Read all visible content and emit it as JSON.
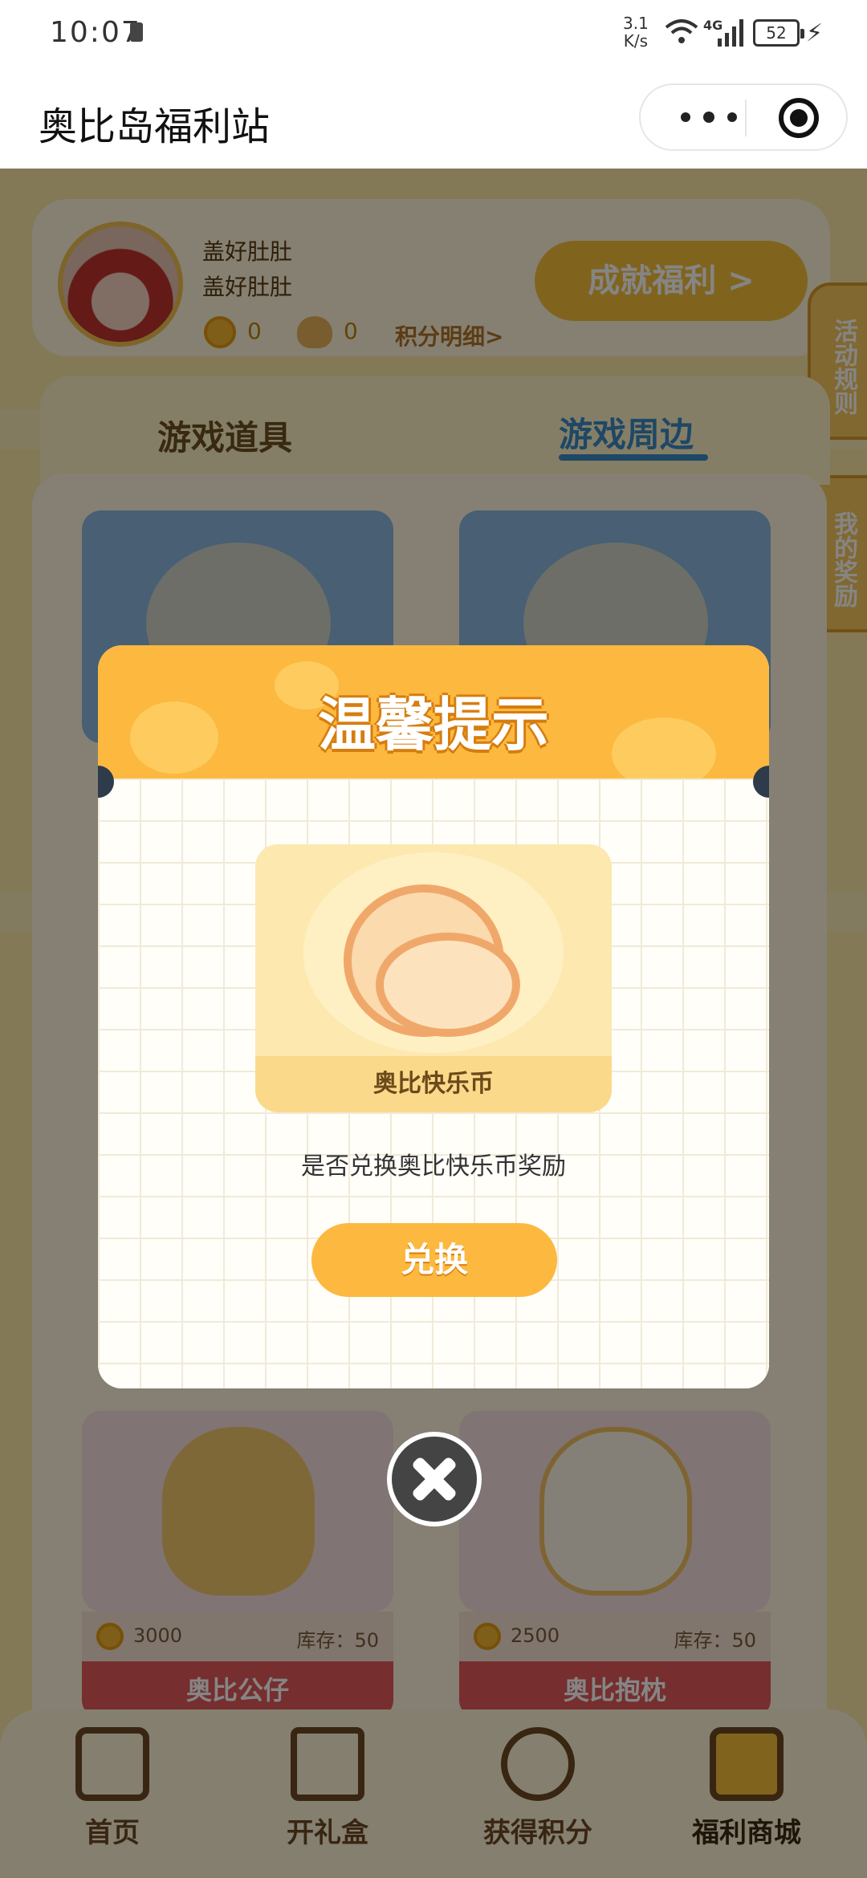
{
  "status_bar": {
    "time": "10:07",
    "speed_value": "3.1",
    "speed_unit": "K/s",
    "network": "4G",
    "battery": "52"
  },
  "title_bar": {
    "title": "奥比岛福利站"
  },
  "profile": {
    "name_line1": "盖好肚肚",
    "name_line2": "盖好肚肚",
    "coins": "0",
    "points": "0",
    "detail_link": "积分明细>",
    "achievement_button": "成就福利 >"
  },
  "side_tabs": {
    "rules": "活动规则",
    "rewards": "我的奖励"
  },
  "category_tabs": {
    "tab1": "游戏道具",
    "tab2": "游戏周边"
  },
  "products": [
    {
      "price": "3000",
      "stock": "库存：50",
      "name": "奥比公仔"
    },
    {
      "price": "2500",
      "stock": "库存：50",
      "name": "奥比抱枕"
    }
  ],
  "bottom_nav": {
    "home": "首页",
    "gift": "开礼盒",
    "points": "获得积分",
    "mall": "福利商城"
  },
  "dialog": {
    "title": "温馨提示",
    "item_name": "奥比快乐币",
    "message": "是否兑换奥比快乐币奖励",
    "button": "兑换"
  },
  "colors": {
    "accent": "#fdb83f",
    "page_background": "#fbe8a6",
    "tab_active": "#3b8bc2",
    "product_name_bg": "#e25858"
  }
}
